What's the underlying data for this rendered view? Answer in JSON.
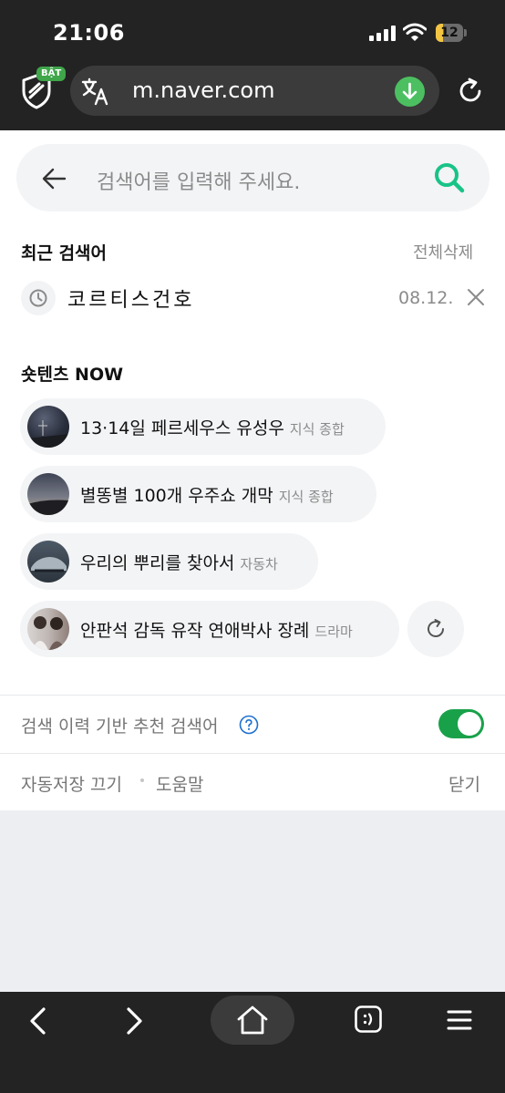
{
  "status_bar": {
    "time": "21:06",
    "battery": "12",
    "battery_level": 0.12
  },
  "browser": {
    "badge": "BẬT",
    "url": "m.naver.com",
    "icons": [
      "shield-icon",
      "translate-icon",
      "download-icon",
      "reload-icon"
    ]
  },
  "search": {
    "placeholder": "검색어를 입력해 주세요."
  },
  "recent": {
    "title": "최근 검색어",
    "clear_all": "전체삭제",
    "items": [
      {
        "term": "코르티스건호",
        "date": "08.12."
      }
    ]
  },
  "shortents": {
    "title": "숏텐츠 NOW",
    "items": [
      {
        "text": "13·14일 페르세우스 유성우",
        "category": "지식 종합"
      },
      {
        "text": "별똥별 100개 우주쇼 개막",
        "category": "지식 종합"
      },
      {
        "text": "우리의 뿌리를 찾아서",
        "category": "자동차"
      },
      {
        "text": "안판석 감독 유작 연애박사 장례",
        "category": "드라마"
      }
    ]
  },
  "recommendation": {
    "label": "검색 이력 기반 추천 검색어",
    "enabled": true
  },
  "footer": {
    "autosave_off": "자동저장 끄기",
    "help": "도움말",
    "close": "닫기"
  },
  "colors": {
    "accent": "#19a14a",
    "search_icon": "#19c387",
    "chrome": "#232323"
  }
}
